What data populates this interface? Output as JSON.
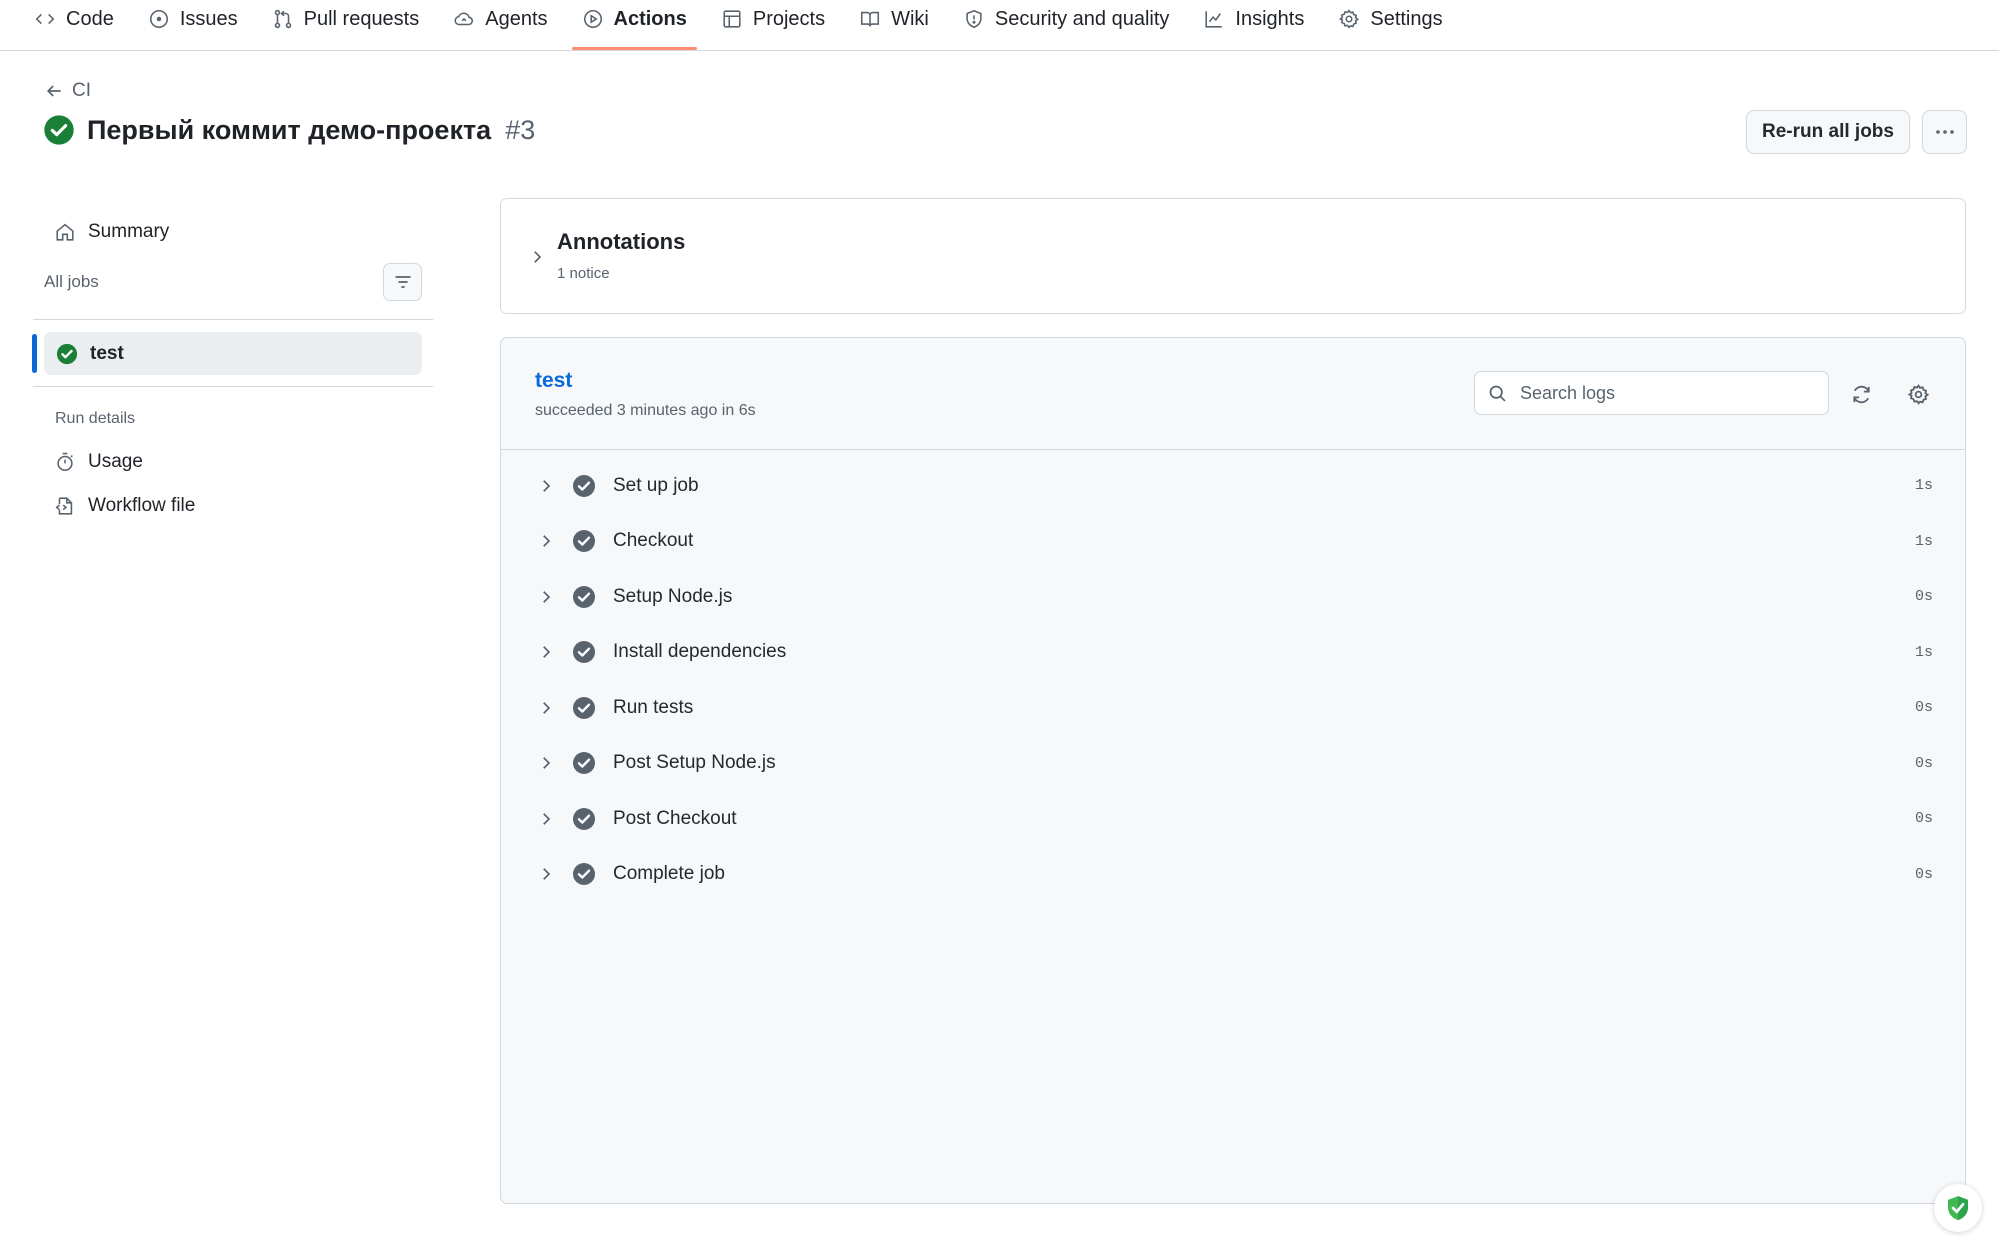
{
  "nav": {
    "items": [
      {
        "label": "Code",
        "icon": "code-icon"
      },
      {
        "label": "Issues",
        "icon": "issue-icon"
      },
      {
        "label": "Pull requests",
        "icon": "pull-request-icon"
      },
      {
        "label": "Agents",
        "icon": "agents-icon"
      },
      {
        "label": "Actions",
        "icon": "play-icon",
        "active": true
      },
      {
        "label": "Projects",
        "icon": "table-icon"
      },
      {
        "label": "Wiki",
        "icon": "book-icon"
      },
      {
        "label": "Security and quality",
        "icon": "shield-icon"
      },
      {
        "label": "Insights",
        "icon": "graph-icon"
      },
      {
        "label": "Settings",
        "icon": "gear-icon"
      }
    ]
  },
  "header": {
    "back_label": "CI",
    "run_title": "Первый коммит демо-проекта",
    "run_number": "#3",
    "rerun_label": "Re-run all jobs",
    "more_label": "···"
  },
  "sidebar": {
    "summary_label": "Summary",
    "all_jobs_label": "All jobs",
    "jobs": [
      {
        "label": "test",
        "status": "success"
      }
    ],
    "run_details_label": "Run details",
    "usage_label": "Usage",
    "workflow_file_label": "Workflow file"
  },
  "annotations": {
    "title": "Annotations",
    "subtitle": "1 notice"
  },
  "job": {
    "name": "test",
    "status_text": "succeeded 3 minutes ago in 6s",
    "search_placeholder": "Search logs",
    "steps": [
      {
        "name": "Set up job",
        "duration": "1s"
      },
      {
        "name": "Checkout",
        "duration": "1s"
      },
      {
        "name": "Setup Node.js",
        "duration": "0s"
      },
      {
        "name": "Install dependencies",
        "duration": "1s"
      },
      {
        "name": "Run tests",
        "duration": "0s"
      },
      {
        "name": "Post Setup Node.js",
        "duration": "0s"
      },
      {
        "name": "Post Checkout",
        "duration": "0s"
      },
      {
        "name": "Complete job",
        "duration": "0s"
      }
    ]
  },
  "colors": {
    "accent": "#0969da",
    "success": "#1a7f37",
    "active_tab_underline": "#fd8c73",
    "step_check": "#59636e"
  }
}
